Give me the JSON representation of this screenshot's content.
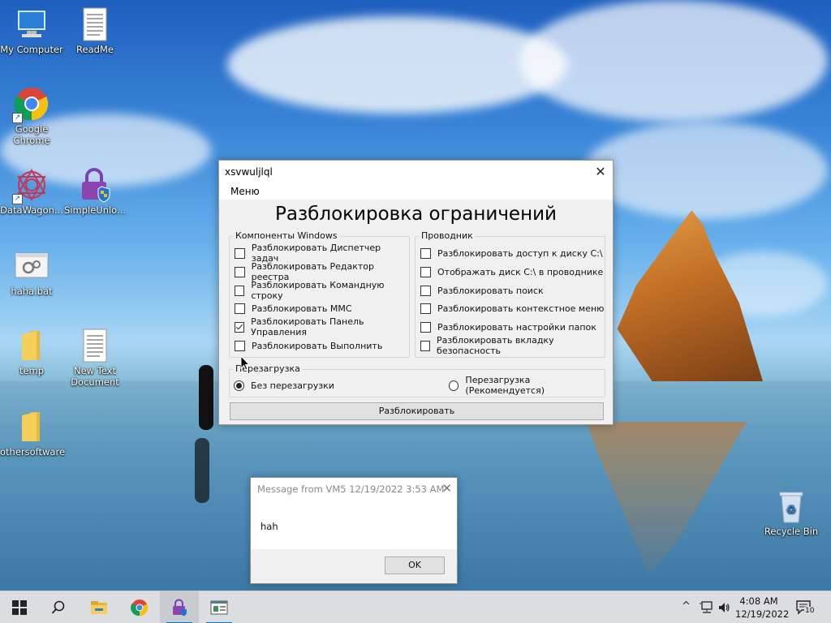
{
  "desktop_icons": [
    {
      "name": "My Computer",
      "icon": "computer-icon"
    },
    {
      "name": "ReadMe",
      "icon": "text-document-icon"
    },
    {
      "name": "Google Chrome",
      "icon": "chrome-icon"
    },
    {
      "name": "DataWagon...",
      "icon": "datawagon-icon"
    },
    {
      "name": "SimpleUnlo...",
      "icon": "padlock-shield-icon"
    },
    {
      "name": "haha.bat",
      "icon": "batch-file-icon"
    },
    {
      "name": "temp",
      "icon": "folder-icon"
    },
    {
      "name": "New Text Document",
      "icon": "text-document-icon"
    },
    {
      "name": "othersoftware",
      "icon": "folder-icon"
    },
    {
      "name": "Recycle Bin",
      "icon": "recycle-bin-icon"
    }
  ],
  "main_window": {
    "title": "xsvwuljlql",
    "close_glyph": "✕",
    "menu": "Меню",
    "heading": "Разблокировка ограничений",
    "groups": {
      "windows": {
        "title": "Компоненты Windows",
        "items": [
          {
            "label": "Разблокировать Диспетчер задач",
            "checked": false
          },
          {
            "label": "Разблокировать Редактор реестра",
            "checked": false
          },
          {
            "label": "Разблокировать Командную строку",
            "checked": false
          },
          {
            "label": "Разблокировать MMC",
            "checked": false
          },
          {
            "label": "Разблокировать Панель Управления",
            "checked": true
          },
          {
            "label": "Разблокировать Выполнить",
            "checked": false
          }
        ]
      },
      "explorer": {
        "title": "Проводник",
        "items": [
          {
            "label": "Разблокировать доступ к диску C:\\",
            "checked": false
          },
          {
            "label": "Отображать диск C:\\ в проводнике",
            "checked": false
          },
          {
            "label": "Разблокировать поиск",
            "checked": false
          },
          {
            "label": "Разблокировать контекстное меню",
            "checked": false
          },
          {
            "label": "Разблокировать настройки папок",
            "checked": false
          },
          {
            "label": "Разблокировать вкладку безопасность",
            "checked": false
          }
        ]
      },
      "reboot": {
        "title": "Перезагрузка",
        "options": [
          {
            "label": "Без перезагрузки",
            "selected": true
          },
          {
            "label": "Перезагрузка (Рекомендуется)",
            "selected": false
          }
        ]
      }
    },
    "button": "Разблокировать"
  },
  "message_box": {
    "title": "Message from VM5 12/19/2022 3:53 AM",
    "close_glyph": "✕",
    "text": "hah",
    "ok": "OK"
  },
  "taskbar": {
    "items": [
      {
        "icon": "windows-start-icon"
      },
      {
        "icon": "search-icon"
      },
      {
        "icon": "file-explorer-icon"
      },
      {
        "icon": "chrome-icon"
      },
      {
        "icon": "padlock-shield-icon"
      },
      {
        "icon": "app-window-icon"
      }
    ],
    "tray": {
      "chevron": "^",
      "time": "4:08 AM",
      "date": "12/19/2022",
      "notifications": "10"
    }
  }
}
